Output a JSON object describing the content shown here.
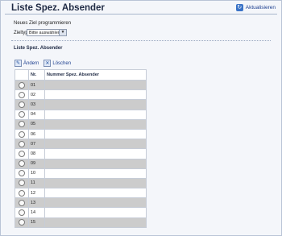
{
  "page": {
    "title": "Liste Spez. Absender",
    "refresh_label": "Aktualisieren",
    "subtitle_new": "Neues Ziel programmieren",
    "zieltyp_label": "Zieltyp",
    "zieltyp_select_value": "Bitte auswählen",
    "section_title": "Liste Spez. Absender"
  },
  "toolbar": {
    "edit_label": "Ändern",
    "delete_label": "Löschen"
  },
  "table": {
    "headers": [
      "Nr.",
      "Nummer Spez. Absender"
    ],
    "rows": [
      {
        "nr": "01",
        "value": ""
      },
      {
        "nr": "02",
        "value": ""
      },
      {
        "nr": "03",
        "value": ""
      },
      {
        "nr": "04",
        "value": ""
      },
      {
        "nr": "05",
        "value": ""
      },
      {
        "nr": "06",
        "value": ""
      },
      {
        "nr": "07",
        "value": ""
      },
      {
        "nr": "08",
        "value": ""
      },
      {
        "nr": "09",
        "value": ""
      },
      {
        "nr": "10",
        "value": ""
      },
      {
        "nr": "11",
        "value": ""
      },
      {
        "nr": "12",
        "value": ""
      },
      {
        "nr": "13",
        "value": ""
      },
      {
        "nr": "14",
        "value": ""
      },
      {
        "nr": "15",
        "value": ""
      }
    ]
  },
  "icons": {
    "refresh": "refresh-icon",
    "edit": "edit-icon",
    "delete": "delete-icon",
    "dropdown": "chevron-down-icon"
  }
}
